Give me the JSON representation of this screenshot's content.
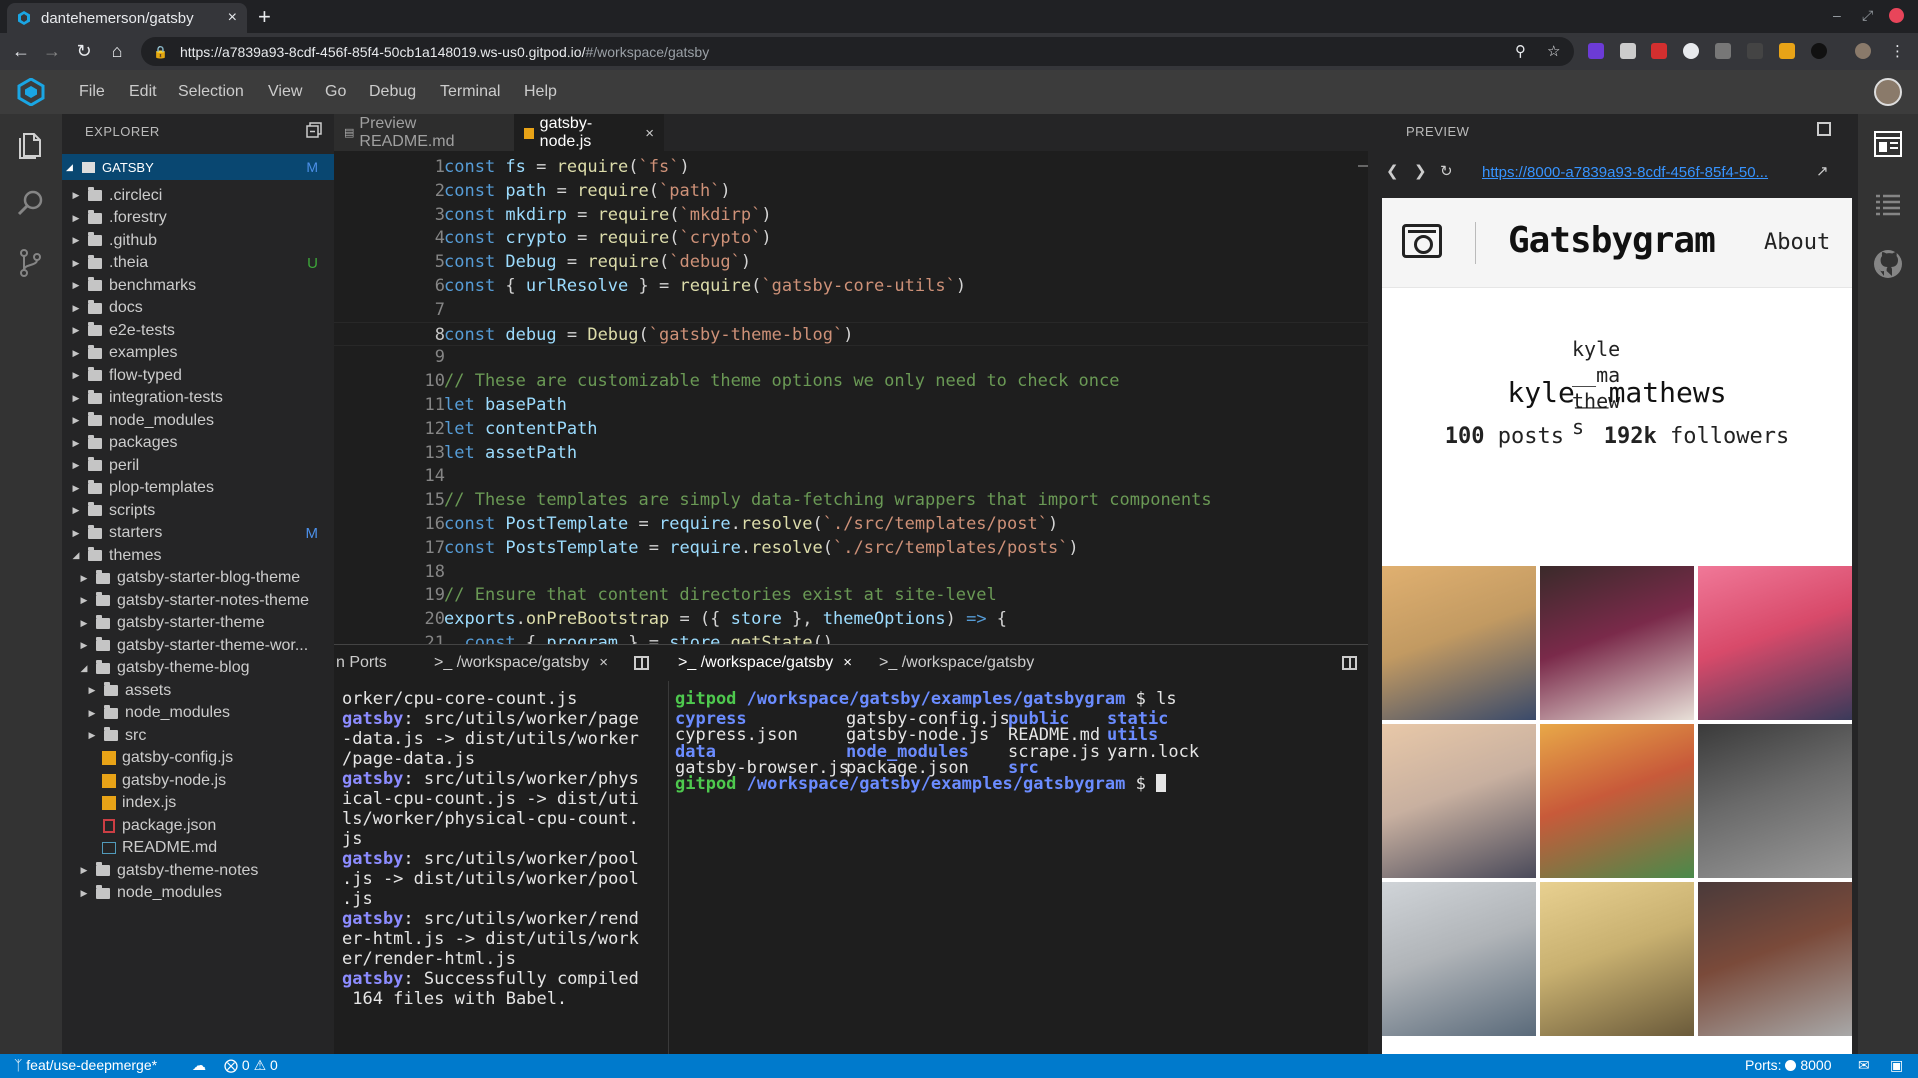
{
  "browser": {
    "tab_title": "dantehemerson/gatsby",
    "tab_close": "×",
    "new_tab": "+",
    "url_main": "https://a7839a93-8cdf-456f-85f4-50cb1a148019.ws-us0.gitpod.io/",
    "url_hash": "#/workspace/gatsby"
  },
  "menu": {
    "items": [
      "File",
      "Edit",
      "Selection",
      "View",
      "Go",
      "Debug",
      "Terminal",
      "Help"
    ]
  },
  "explorer": {
    "title": "EXPLORER",
    "root": "GATSBY",
    "root_badge": "M",
    "rows": [
      {
        "label": ".circleci",
        "type": "folder",
        "depth": 1,
        "open": false,
        "badge": ""
      },
      {
        "label": ".forestry",
        "type": "folder",
        "depth": 1,
        "open": false,
        "badge": ""
      },
      {
        "label": ".github",
        "type": "folder",
        "depth": 1,
        "open": false,
        "badge": ""
      },
      {
        "label": ".theia",
        "type": "folder",
        "depth": 1,
        "open": false,
        "badge": "U"
      },
      {
        "label": "benchmarks",
        "type": "folder",
        "depth": 1,
        "open": false,
        "badge": ""
      },
      {
        "label": "docs",
        "type": "folder",
        "depth": 1,
        "open": false,
        "badge": ""
      },
      {
        "label": "e2e-tests",
        "type": "folder",
        "depth": 1,
        "open": false,
        "badge": ""
      },
      {
        "label": "examples",
        "type": "folder",
        "depth": 1,
        "open": false,
        "badge": ""
      },
      {
        "label": "flow-typed",
        "type": "folder",
        "depth": 1,
        "open": false,
        "badge": ""
      },
      {
        "label": "integration-tests",
        "type": "folder",
        "depth": 1,
        "open": false,
        "badge": ""
      },
      {
        "label": "node_modules",
        "type": "folder",
        "depth": 1,
        "open": false,
        "badge": ""
      },
      {
        "label": "packages",
        "type": "folder",
        "depth": 1,
        "open": false,
        "badge": ""
      },
      {
        "label": "peril",
        "type": "folder",
        "depth": 1,
        "open": false,
        "badge": ""
      },
      {
        "label": "plop-templates",
        "type": "folder",
        "depth": 1,
        "open": false,
        "badge": ""
      },
      {
        "label": "scripts",
        "type": "folder",
        "depth": 1,
        "open": false,
        "badge": ""
      },
      {
        "label": "starters",
        "type": "folder",
        "depth": 1,
        "open": false,
        "badge": "M"
      },
      {
        "label": "themes",
        "type": "folder",
        "depth": 1,
        "open": true,
        "badge": ""
      },
      {
        "label": "gatsby-starter-blog-theme",
        "type": "folder",
        "depth": 2,
        "open": false,
        "badge": ""
      },
      {
        "label": "gatsby-starter-notes-theme",
        "type": "folder",
        "depth": 2,
        "open": false,
        "badge": ""
      },
      {
        "label": "gatsby-starter-theme",
        "type": "folder",
        "depth": 2,
        "open": false,
        "badge": ""
      },
      {
        "label": "gatsby-starter-theme-wor...",
        "type": "folder",
        "depth": 2,
        "open": false,
        "badge": ""
      },
      {
        "label": "gatsby-theme-blog",
        "type": "folder",
        "depth": 2,
        "open": true,
        "badge": ""
      },
      {
        "label": "assets",
        "type": "folder",
        "depth": 3,
        "open": false,
        "badge": ""
      },
      {
        "label": "node_modules",
        "type": "folder",
        "depth": 3,
        "open": false,
        "badge": ""
      },
      {
        "label": "src",
        "type": "folder",
        "depth": 3,
        "open": false,
        "badge": ""
      },
      {
        "label": "gatsby-config.js",
        "type": "js",
        "depth": 3,
        "open": false,
        "badge": ""
      },
      {
        "label": "gatsby-node.js",
        "type": "js",
        "depth": 3,
        "open": false,
        "badge": ""
      },
      {
        "label": "index.js",
        "type": "js",
        "depth": 3,
        "open": false,
        "badge": ""
      },
      {
        "label": "package.json",
        "type": "json",
        "depth": 3,
        "open": false,
        "badge": ""
      },
      {
        "label": "README.md",
        "type": "md",
        "depth": 3,
        "open": false,
        "badge": ""
      },
      {
        "label": "gatsby-theme-notes",
        "type": "folder",
        "depth": 2,
        "open": false,
        "badge": ""
      },
      {
        "label": "node_modules",
        "type": "folder",
        "depth": 2,
        "open": false,
        "badge": ""
      }
    ]
  },
  "editor": {
    "tabs": [
      {
        "label": "Preview README.md",
        "active": false
      },
      {
        "label": "gatsby-node.js",
        "active": true
      }
    ],
    "tab_close": "×",
    "current_line": 8,
    "lines": [
      [
        [
          "kw",
          "const "
        ],
        [
          "vr",
          "fs"
        ],
        [
          "pl",
          " = "
        ],
        [
          "fn",
          "require"
        ],
        [
          "pl",
          "("
        ],
        [
          "st",
          "`fs`"
        ],
        [
          "pl",
          ")"
        ]
      ],
      [
        [
          "kw",
          "const "
        ],
        [
          "vr",
          "path"
        ],
        [
          "pl",
          " = "
        ],
        [
          "fn",
          "require"
        ],
        [
          "pl",
          "("
        ],
        [
          "st",
          "`path`"
        ],
        [
          "pl",
          ")"
        ]
      ],
      [
        [
          "kw",
          "const "
        ],
        [
          "vr",
          "mkdirp"
        ],
        [
          "pl",
          " = "
        ],
        [
          "fn",
          "require"
        ],
        [
          "pl",
          "("
        ],
        [
          "st",
          "`mkdirp`"
        ],
        [
          "pl",
          ")"
        ]
      ],
      [
        [
          "kw",
          "const "
        ],
        [
          "vr",
          "crypto"
        ],
        [
          "pl",
          " = "
        ],
        [
          "fn",
          "require"
        ],
        [
          "pl",
          "("
        ],
        [
          "st",
          "`crypto`"
        ],
        [
          "pl",
          ")"
        ]
      ],
      [
        [
          "kw",
          "const "
        ],
        [
          "vr",
          "Debug"
        ],
        [
          "pl",
          " = "
        ],
        [
          "fn",
          "require"
        ],
        [
          "pl",
          "("
        ],
        [
          "st",
          "`debug`"
        ],
        [
          "pl",
          ")"
        ]
      ],
      [
        [
          "kw",
          "const "
        ],
        [
          "pl",
          "{ "
        ],
        [
          "vr",
          "urlResolve"
        ],
        [
          "pl",
          " } = "
        ],
        [
          "fn",
          "require"
        ],
        [
          "pl",
          "("
        ],
        [
          "st",
          "`gatsby-core-utils`"
        ],
        [
          "pl",
          ")"
        ]
      ],
      [],
      [
        [
          "kw",
          "const "
        ],
        [
          "vr",
          "debug"
        ],
        [
          "pl",
          " = "
        ],
        [
          "fn",
          "Debug"
        ],
        [
          "pl",
          "("
        ],
        [
          "st",
          "`gatsby-theme-blog`"
        ],
        [
          "pl",
          ")"
        ]
      ],
      [],
      [
        [
          "cm",
          "// These are customizable theme options we only need to check once"
        ]
      ],
      [
        [
          "kw",
          "let "
        ],
        [
          "vr",
          "basePath"
        ]
      ],
      [
        [
          "kw",
          "let "
        ],
        [
          "vr",
          "contentPath"
        ]
      ],
      [
        [
          "kw",
          "let "
        ],
        [
          "vr",
          "assetPath"
        ]
      ],
      [],
      [
        [
          "cm",
          "// These templates are simply data-fetching wrappers that import components"
        ]
      ],
      [
        [
          "kw",
          "const "
        ],
        [
          "vr",
          "PostTemplate"
        ],
        [
          "pl",
          " = "
        ],
        [
          "vr",
          "require"
        ],
        [
          "pl",
          "."
        ],
        [
          "fn",
          "resolve"
        ],
        [
          "pl",
          "("
        ],
        [
          "st",
          "`./src/templates/post`"
        ],
        [
          "pl",
          ")"
        ]
      ],
      [
        [
          "kw",
          "const "
        ],
        [
          "vr",
          "PostsTemplate"
        ],
        [
          "pl",
          " = "
        ],
        [
          "vr",
          "require"
        ],
        [
          "pl",
          "."
        ],
        [
          "fn",
          "resolve"
        ],
        [
          "pl",
          "("
        ],
        [
          "st",
          "`./src/templates/posts`"
        ],
        [
          "pl",
          ")"
        ]
      ],
      [],
      [
        [
          "cm",
          "// Ensure that content directories exist at site-level"
        ]
      ],
      [
        [
          "vr",
          "exports"
        ],
        [
          "pl",
          "."
        ],
        [
          "fn",
          "onPreBootstrap"
        ],
        [
          "pl",
          " = ({ "
        ],
        [
          "vr",
          "store"
        ],
        [
          "pl",
          " }, "
        ],
        [
          "vr",
          "themeOptions"
        ],
        [
          "pl",
          ") "
        ],
        [
          "kw",
          "=>"
        ],
        [
          "pl",
          " {"
        ]
      ],
      [
        [
          "pl",
          "  "
        ],
        [
          "kw",
          "const "
        ],
        [
          "pl",
          "{ "
        ],
        [
          "vr",
          "program"
        ],
        [
          "pl",
          " } = "
        ],
        [
          "vr",
          "store"
        ],
        [
          "pl",
          "."
        ],
        [
          "fn",
          "getState"
        ],
        [
          "pl",
          "()"
        ]
      ]
    ]
  },
  "terminal": {
    "tabs": [
      {
        "label": "n Ports"
      },
      {
        "label": ">_ /workspace/gatsby",
        "close": "×"
      },
      {
        "label": ">_ /workspace/gatsby",
        "close": "×"
      },
      {
        "label": ">_ /workspace/gatsby"
      }
    ],
    "left_pane": [
      [
        [
          "t-white",
          "orker/cpu-core-count.js"
        ]
      ],
      [
        [
          "t-bold",
          "gatsby"
        ],
        [
          "t-white",
          ": src/utils/worker/page"
        ]
      ],
      [
        [
          "t-white",
          "-data.js -> dist/utils/worker"
        ]
      ],
      [
        [
          "t-white",
          "/page-data.js"
        ]
      ],
      [
        [
          "t-bold",
          "gatsby"
        ],
        [
          "t-white",
          ": src/utils/worker/phys"
        ]
      ],
      [
        [
          "t-white",
          "ical-cpu-count.js -> dist/uti"
        ]
      ],
      [
        [
          "t-white",
          "ls/worker/physical-cpu-count."
        ]
      ],
      [
        [
          "t-white",
          "js"
        ]
      ],
      [
        [
          "t-bold",
          "gatsby"
        ],
        [
          "t-white",
          ": src/utils/worker/pool"
        ]
      ],
      [
        [
          "t-white",
          ".js -> dist/utils/worker/pool"
        ]
      ],
      [
        [
          "t-white",
          ".js"
        ]
      ],
      [
        [
          "t-bold",
          "gatsby"
        ],
        [
          "t-white",
          ": src/utils/worker/rend"
        ]
      ],
      [
        [
          "t-white",
          "er-html.js -> dist/utils/work"
        ]
      ],
      [
        [
          "t-white",
          "er/render-html.js"
        ]
      ],
      [
        [
          "t-bold",
          "gatsby"
        ],
        [
          "t-white",
          ": Successfully compiled"
        ]
      ],
      [
        [
          "t-white",
          " 164 files with Babel."
        ]
      ]
    ],
    "right_pane": {
      "prompt_user": "gitpod",
      "prompt_path": "/workspace/gatsby/examples/gatsbygram",
      "prompt_symbol": "$",
      "command": "ls",
      "listing": [
        [
          [
            "t-blue",
            "cypress"
          ],
          [
            "t-file",
            "cypress.json"
          ],
          [
            "t-blue",
            "data"
          ],
          [
            "t-file",
            "gatsby-browser.js"
          ]
        ],
        [
          [
            "t-file",
            "gatsby-config.js"
          ],
          [
            "t-file",
            "gatsby-node.js"
          ],
          [
            "t-blue",
            "node_modules"
          ],
          [
            "t-file",
            "package.json"
          ]
        ],
        [
          [
            "t-blue",
            "public"
          ],
          [
            "t-file",
            "README.md"
          ],
          [
            "t-file",
            "scrape.js"
          ],
          [
            "t-blue",
            "src"
          ]
        ],
        [
          [
            "t-blue",
            "static"
          ],
          [
            "t-blue",
            "utils"
          ],
          [
            "t-file",
            "yarn.lock"
          ],
          [
            "t-file",
            ""
          ]
        ]
      ]
    }
  },
  "preview": {
    "title": "PREVIEW",
    "url": "https://8000-a7839a93-8cdf-456f-85f4-50...",
    "site": {
      "brand": "Gatsbygram",
      "about": "About",
      "avatar_alt": "kyle__mathews",
      "username": "kyle__mathews",
      "posts_count": "100",
      "posts_label": "posts",
      "followers_count": "192k",
      "followers_label": "followers",
      "photos": [
        {
          "name": "photo-venice-canal",
          "colors": [
            "#c29a62",
            "#3a4a6a",
            "#e0b070"
          ]
        },
        {
          "name": "photo-food-plates",
          "colors": [
            "#7a2a4a",
            "#e8e0d8",
            "#3a2a2a"
          ]
        },
        {
          "name": "photo-flower-wall",
          "colors": [
            "#d84a6a",
            "#3a3a5a",
            "#f07898"
          ]
        },
        {
          "name": "photo-flag-sunset",
          "colors": [
            "#c8b0a0",
            "#4a4a5a",
            "#e8c8a8"
          ]
        },
        {
          "name": "photo-candy-market",
          "colors": [
            "#c85a3a",
            "#4a8a4a",
            "#e8a848"
          ]
        },
        {
          "name": "photo-pebbles",
          "colors": [
            "#6a6a6a",
            "#9a9a9a",
            "#3a3a3a"
          ]
        },
        {
          "name": "photo-harbor-city",
          "colors": [
            "#b0b4b8",
            "#5a6a7a",
            "#d0d4d8"
          ]
        },
        {
          "name": "photo-shop-display",
          "colors": [
            "#c8b070",
            "#6a5a3a",
            "#e8d090"
          ]
        },
        {
          "name": "photo-brick-street",
          "colors": [
            "#7a4a3a",
            "#a8a8a8",
            "#4a3a3a"
          ]
        }
      ]
    }
  },
  "statusbar": {
    "branch": "feat/use-deepmerge*",
    "errors": "0",
    "warnings": "0",
    "ports_label": "Ports:",
    "ports_value": "8000"
  }
}
